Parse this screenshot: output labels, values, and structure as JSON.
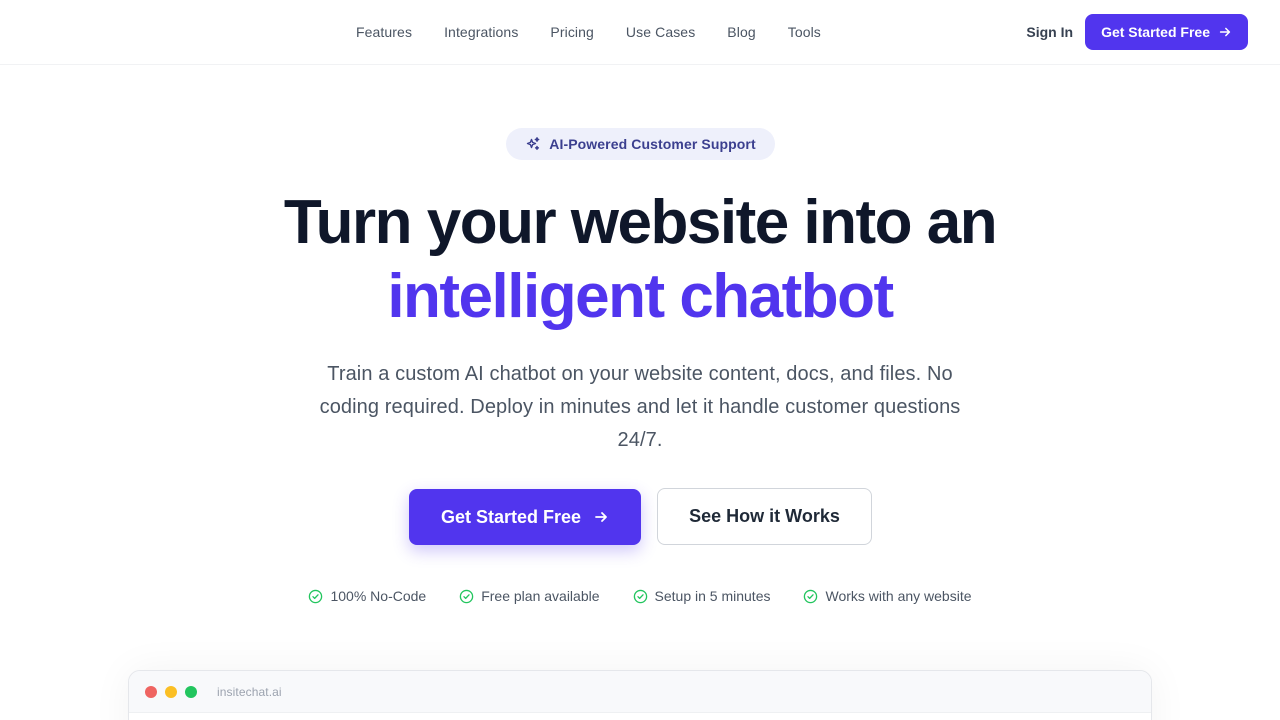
{
  "nav": {
    "links": [
      "Features",
      "Integrations",
      "Pricing",
      "Use Cases",
      "Blog",
      "Tools"
    ],
    "sign_in": "Sign In",
    "cta": "Get Started Free"
  },
  "hero": {
    "badge": "AI-Powered Customer Support",
    "title_line1": "Turn your website into an",
    "title_line2": "intelligent chatbot",
    "subtitle": "Train a custom AI chatbot on your website content, docs, and files. No coding required. Deploy in minutes and let it handle customer questions 24/7.",
    "primary_cta": "Get Started Free",
    "secondary_cta": "See How it Works",
    "features": [
      "100% No-Code",
      "Free plan available",
      "Setup in 5 minutes",
      "Works with any website"
    ]
  },
  "preview": {
    "url": "insitechat.ai"
  },
  "colors": {
    "brand": "#5135EE",
    "check": "#22C55E",
    "dot_red": "#EF6461",
    "dot_yellow": "#FBBF24",
    "dot_green": "#22C55E"
  },
  "icons": {
    "badge": "sparkles-icon",
    "cta": "arrow-right-icon",
    "feature": "check-circle-icon"
  }
}
